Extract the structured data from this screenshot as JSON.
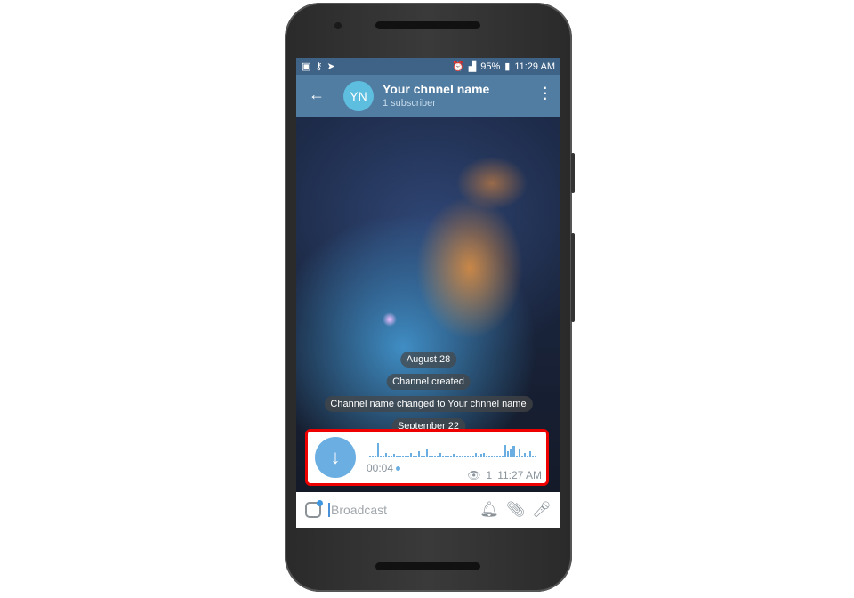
{
  "status_bar": {
    "percent": "95%",
    "time": "11:29 AM"
  },
  "header": {
    "avatar_initials": "YN",
    "title": "Your chnnel name",
    "subtitle": "1 subscriber"
  },
  "service_messages": [
    "August 28",
    "Channel created",
    "Channel name changed to Your chnnel name",
    "September 22"
  ],
  "voice_message": {
    "duration": "00:04",
    "views": "1",
    "time": "11:27 AM",
    "waveform": [
      0.1,
      0.1,
      0.1,
      0.9,
      0.1,
      0.1,
      0.3,
      0.1,
      0.1,
      0.2,
      0.1,
      0.1,
      0.1,
      0.1,
      0.1,
      0.3,
      0.1,
      0.1,
      0.4,
      0.1,
      0.1,
      0.5,
      0.1,
      0.1,
      0.1,
      0.1,
      0.3,
      0.1,
      0.1,
      0.1,
      0.1,
      0.2,
      0.1,
      0.1,
      0.1,
      0.1,
      0.1,
      0.1,
      0.1,
      0.3,
      0.1,
      0.2,
      0.3,
      0.1,
      0.1,
      0.1,
      0.1,
      0.1,
      0.1,
      0.1,
      0.8,
      0.4,
      0.5,
      0.7,
      0.1,
      0.5,
      0.1,
      0.3,
      0.1,
      0.4,
      0.1,
      0.1
    ],
    "accent": "#6aaee2"
  },
  "composer": {
    "placeholder": "Broadcast"
  },
  "colors": {
    "header": "#517da2",
    "status_bar": "#3f6287",
    "highlight": "#ee0000"
  }
}
